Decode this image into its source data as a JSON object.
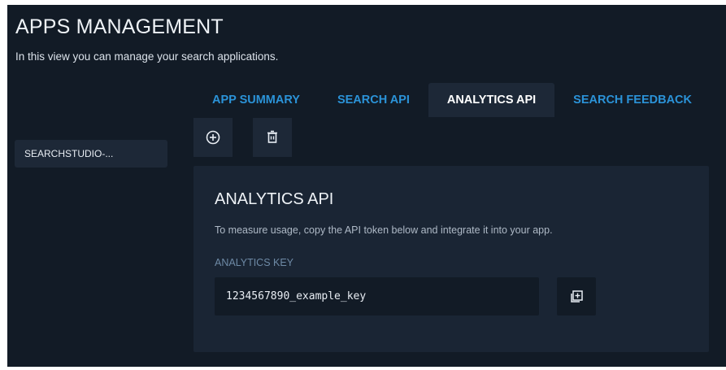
{
  "header": {
    "title": "APPS MANAGEMENT",
    "subtitle": "In this view you can manage your search applications."
  },
  "sidebar": {
    "items": [
      {
        "label": "SEARCHSTUDIO-..."
      }
    ]
  },
  "tabs": [
    {
      "label": "APP SUMMARY",
      "active": false
    },
    {
      "label": "SEARCH API",
      "active": false
    },
    {
      "label": "ANALYTICS API",
      "active": true
    },
    {
      "label": "SEARCH FEEDBACK",
      "active": false
    }
  ],
  "toolbar": {
    "buttons": [
      {
        "icon": "add-circle-icon"
      },
      {
        "icon": "trash-icon"
      }
    ]
  },
  "panel": {
    "title": "ANALYTICS API",
    "description": "To measure usage, copy the API token below and integrate it into your app.",
    "key_label": "ANALYTICS KEY",
    "key_value": "1234567890_example_key",
    "copy_icon": "copy-icon"
  },
  "colors": {
    "background": "#121b26",
    "surface": "#1d2837",
    "panel": "#1a2534",
    "accent": "#2b93d8",
    "muted_label": "#6e8aa6"
  }
}
